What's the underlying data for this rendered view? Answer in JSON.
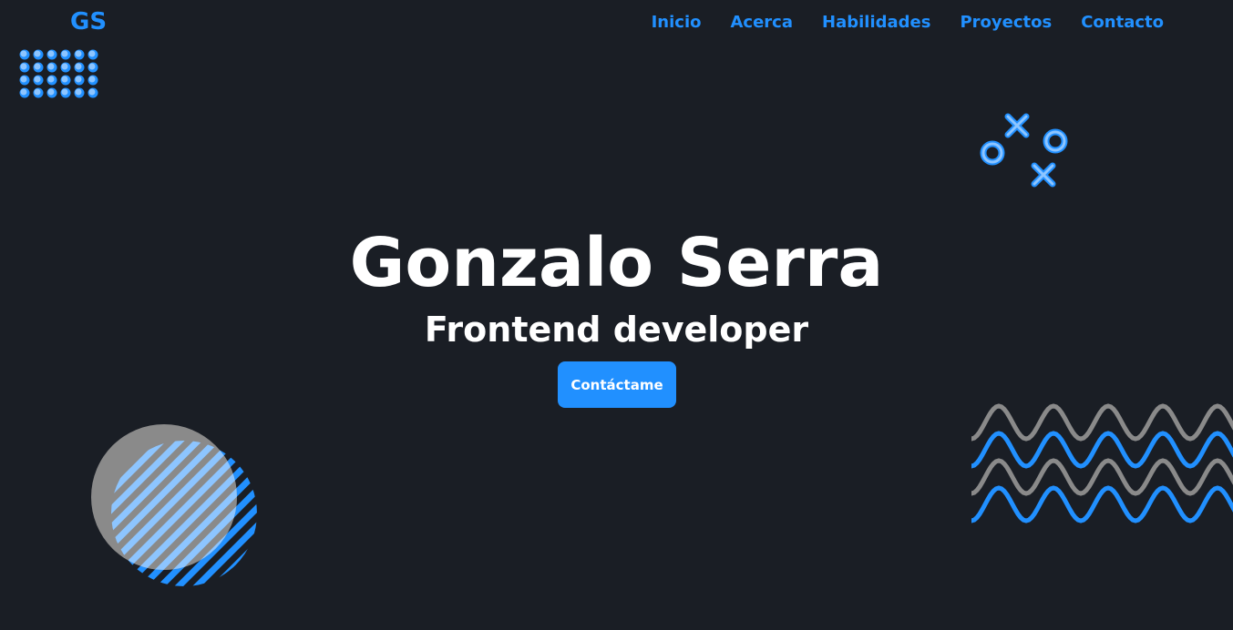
{
  "header": {
    "logo": "GS",
    "nav": [
      {
        "label": "Inicio"
      },
      {
        "label": "Acerca"
      },
      {
        "label": "Habilidades"
      },
      {
        "label": "Proyectos"
      },
      {
        "label": "Contacto"
      }
    ]
  },
  "hero": {
    "name": "Gonzalo Serra",
    "role": "Frontend developer",
    "cta_label": "Contáctame"
  },
  "colors": {
    "background": "#1a1e25",
    "accent": "#2190ff",
    "light_accent": "#8dc5ff",
    "gray": "#8a8a8a",
    "text": "#ffffff"
  },
  "decorations": [
    {
      "icon": "dot-grid"
    },
    {
      "icon": "tic-tac-toe"
    },
    {
      "icon": "striped-circles"
    },
    {
      "icon": "wave-lines"
    }
  ]
}
